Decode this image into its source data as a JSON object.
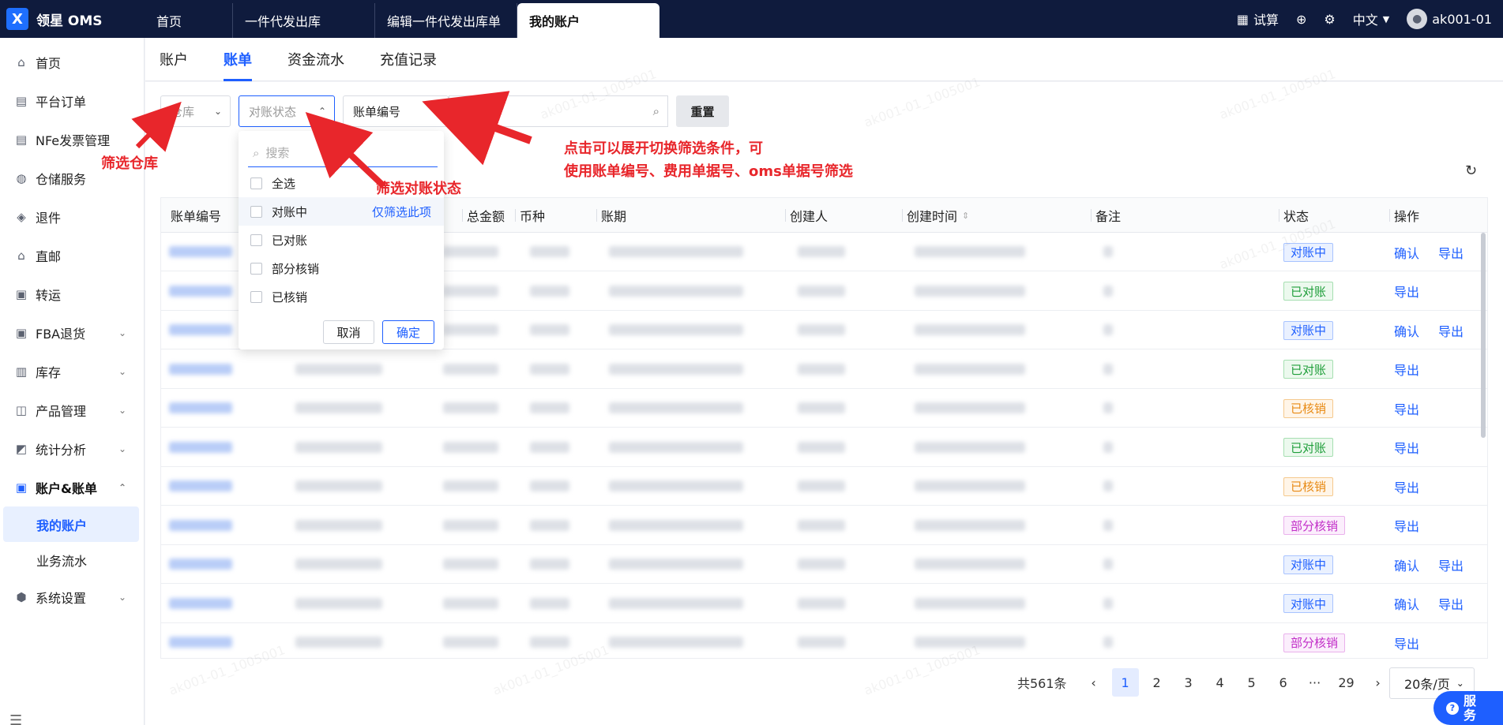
{
  "topbar": {
    "brand": "领星 OMS",
    "tabs": [
      "首页",
      "一件代发出库",
      "编辑一件代发出库单",
      "我的账户"
    ],
    "trial": "试算",
    "lang": "中文",
    "user": "ak001-01"
  },
  "sidebar": {
    "items": [
      {
        "label": "首页",
        "icon": "home-icon"
      },
      {
        "label": "平台订单",
        "icon": "clipboard-icon"
      },
      {
        "label": "NFe发票管理",
        "icon": "invoice-icon"
      },
      {
        "label": "仓储服务",
        "icon": "warehouse-icon"
      },
      {
        "label": "退件",
        "icon": "return-icon"
      },
      {
        "label": "直邮",
        "icon": "mail-icon"
      },
      {
        "label": "转运",
        "icon": "truck-icon"
      },
      {
        "label": "FBA退货",
        "icon": "amazon-icon"
      },
      {
        "label": "库存",
        "icon": "inventory-icon"
      },
      {
        "label": "产品管理",
        "icon": "product-icon"
      },
      {
        "label": "统计分析",
        "icon": "chart-icon"
      },
      {
        "label": "账户&账单",
        "icon": "account-icon"
      }
    ],
    "sub_items": [
      "我的账户",
      "业务流水"
    ],
    "settings": "系统设置"
  },
  "subtabs": [
    "账户",
    "账单",
    "资金流水",
    "充值记录"
  ],
  "filters": {
    "warehouse": "仓库",
    "status": "对账状态",
    "bill_no": "账单编号",
    "reset": "重置"
  },
  "dropdown": {
    "search_placeholder": "搜索",
    "options": [
      "全选",
      "对账中",
      "已对账",
      "部分核销",
      "已核销"
    ],
    "only_this": "仅筛选此项",
    "cancel": "取消",
    "ok": "确定"
  },
  "table": {
    "headers": [
      "账单编号",
      "总金额",
      "币种",
      "账期",
      "创建人",
      "创建时间",
      "备注",
      "状态",
      "操作"
    ],
    "rows": [
      {
        "status": "对账中",
        "color": "blue",
        "ops": [
          "确认",
          "导出"
        ]
      },
      {
        "status": "已对账",
        "color": "green",
        "ops": [
          "导出"
        ]
      },
      {
        "status": "对账中",
        "color": "blue",
        "ops": [
          "确认",
          "导出"
        ]
      },
      {
        "status": "已对账",
        "color": "green",
        "ops": [
          "导出"
        ]
      },
      {
        "status": "已核销",
        "color": "orange",
        "ops": [
          "导出"
        ]
      },
      {
        "status": "已对账",
        "color": "green",
        "ops": [
          "导出"
        ]
      },
      {
        "status": "已核销",
        "color": "orange",
        "ops": [
          "导出"
        ]
      },
      {
        "status": "部分核销",
        "color": "purple",
        "ops": [
          "导出"
        ]
      },
      {
        "status": "对账中",
        "color": "blue",
        "ops": [
          "确认",
          "导出"
        ]
      },
      {
        "status": "对账中",
        "color": "blue",
        "ops": [
          "确认",
          "导出"
        ]
      },
      {
        "status": "部分核销",
        "color": "purple",
        "ops": [
          "导出"
        ]
      }
    ]
  },
  "pager": {
    "total": "共561条",
    "pages": [
      "1",
      "2",
      "3",
      "4",
      "5",
      "6",
      "···",
      "29"
    ],
    "size": "20条/页"
  },
  "service": "服务",
  "annotations": {
    "warehouse": "筛选仓库",
    "status": "筛选对账状态",
    "switch_line1": "点击可以展开切换筛选条件，可",
    "switch_line2": "使用账单编号、费用单据号、oms单据号筛选"
  },
  "watermark": "ak001-01_1005001"
}
